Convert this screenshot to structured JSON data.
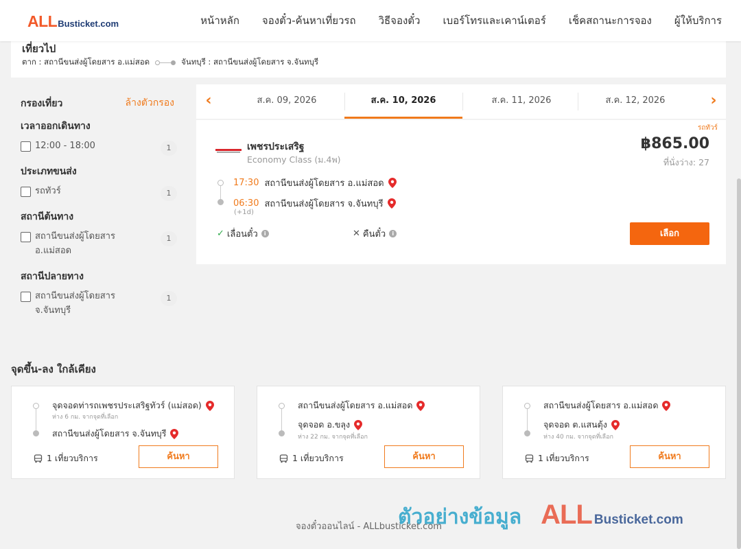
{
  "header": {
    "logo_all": "ALL",
    "logo_rest": "Busticket.com",
    "nav": [
      "หน้าหลัก",
      "จองตั๋ว-ค้นหาเที่ยวรถ",
      "วิธีจองตั๋ว",
      "เบอร์โทรและเคาน์เตอร์",
      "เช็คสถานะการจอง",
      "ผู้ให้บริการ"
    ]
  },
  "route": {
    "title": "เที่ยวไป",
    "origin": "ตาก : สถานีขนส่งผู้โดยสาร อ.แม่สอด",
    "destination": "จันทบุรี : สถานีขนส่งผู้โดยสาร จ.จันทบุรี"
  },
  "filters": {
    "title": "กรองเที่ยว",
    "clear": "ล้างตัวกรอง",
    "groups": [
      {
        "title": "เวลาออกเดินทาง",
        "options": [
          {
            "label": "12:00 - 18:00",
            "count": "1"
          }
        ]
      },
      {
        "title": "ประเภทขนส่ง",
        "options": [
          {
            "label": "รถทัวร์",
            "count": "1"
          }
        ]
      },
      {
        "title": "สถานีต้นทาง",
        "options": [
          {
            "label": "สถานีขนส่งผู้โดยสาร อ.แม่สอด",
            "count": "1"
          }
        ]
      },
      {
        "title": "สถานีปลายทาง",
        "options": [
          {
            "label": "สถานีขนส่งผู้โดยสาร จ.จันทบุรี",
            "count": "1"
          }
        ]
      }
    ]
  },
  "dates": {
    "prev_arrow": "‹",
    "next_arrow": "›",
    "tabs": [
      "ส.ค. 09, 2026",
      "ส.ค. 10, 2026",
      "ส.ค. 11, 2026",
      "ส.ค. 12, 2026"
    ],
    "active_index": 1
  },
  "trip": {
    "tag": "รถทัวร์",
    "operator": "เพชรประเสริฐ",
    "bus_class": "Economy Class (ม.4พ)",
    "price": "฿865.00",
    "seats": "ที่นั่งว่าง: 27",
    "depart_time": "17:30",
    "depart_station": "สถานีขนส่งผู้โดยสาร อ.แม่สอด",
    "arrive_time": "06:30",
    "arrive_station": "สถานีขนส่งผู้โดยสาร จ.จันทบุรี",
    "next_day": "(+1d)",
    "reschedule": "เลื่อนตั๋ว",
    "refund": "คืนตั๋ว",
    "select": "เลือก"
  },
  "nearby": {
    "title": "จุดขึ้น-ลง ใกล้เคียง",
    "cards": [
      {
        "from": "จุดจอดท่ารถเพชรประเสริฐทัวร์ (แม่สอด)",
        "from_dist": "ห่าง 6 กม. จากจุดที่เลือก",
        "to": "สถานีขนส่งผู้โดยสาร จ.จันทบุรี",
        "to_dist": "",
        "trips": "1 เที่ยวบริการ",
        "button": "ค้นหา"
      },
      {
        "from": "สถานีขนส่งผู้โดยสาร อ.แม่สอด",
        "from_dist": "",
        "to": "จุดจอด อ.ขลุง",
        "to_dist": "ห่าง 22 กม. จากจุดที่เลือก",
        "trips": "1 เที่ยวบริการ",
        "button": "ค้นหา"
      },
      {
        "from": "สถานีขนส่งผู้โดยสาร อ.แม่สอด",
        "from_dist": "",
        "to": "จุดจอด ต.แสนตุ้ง",
        "to_dist": "ห่าง 40 กม. จากจุดที่เลือก",
        "trips": "1 เที่ยวบริการ",
        "button": "ค้นหา"
      }
    ]
  },
  "footer": {
    "text": "จองตั๋วออนไลน์ - ALLbusticket.com"
  },
  "watermark": {
    "thai": "ตัวอย่างข้อมูล",
    "all": "ALL",
    "rest": "Busticket.com"
  },
  "colors": {
    "accent": "#f07a1c",
    "button": "#f4660f",
    "logo_orange": "#f25a2a",
    "logo_navy": "#1f3c74"
  }
}
